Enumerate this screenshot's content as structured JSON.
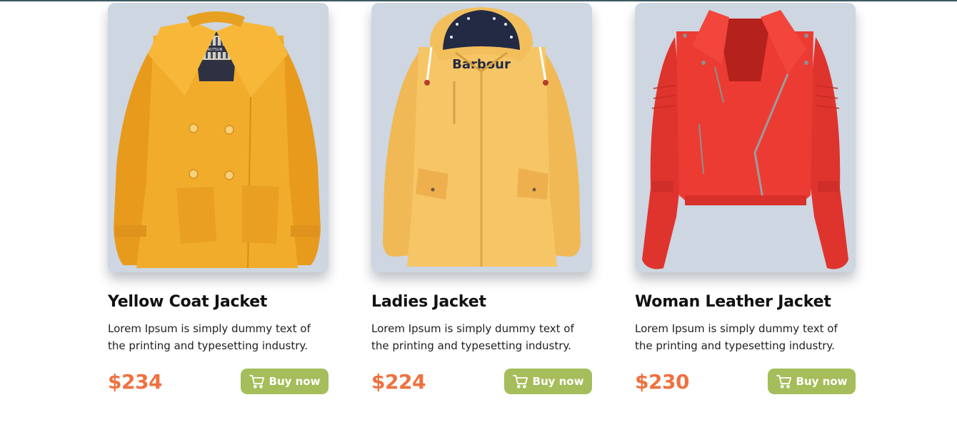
{
  "products": [
    {
      "title": "Yellow Coat Jacket",
      "description": "Lorem Ipsum is simply dummy text of the printing and typesetting industry.",
      "price": "$234",
      "button_label": "Buy now",
      "image_icon": "yellow-coat-jacket-image",
      "jacket_color": "#f2ac2c",
      "tag_text": "RUTSUN"
    },
    {
      "title": "Ladies Jacket",
      "description": "Lorem Ipsum is simply dummy text of the printing and typesetting industry.",
      "price": "$224",
      "button_label": "Buy now",
      "image_icon": "ladies-jacket-image",
      "jacket_color": "#f6c566",
      "tag_text": "Barbour"
    },
    {
      "title": "Woman Leather Jacket",
      "description": "Lorem Ipsum is simply dummy text of the printing and typesetting industry.",
      "price": "$230",
      "button_label": "Buy now",
      "image_icon": "red-leather-jacket-image",
      "jacket_color": "#ec3b33"
    }
  ],
  "colors": {
    "card_background": "#cdd6e1",
    "price": "#ef7140",
    "button": "#a5bd5a",
    "top_rule": "#3e5964"
  }
}
